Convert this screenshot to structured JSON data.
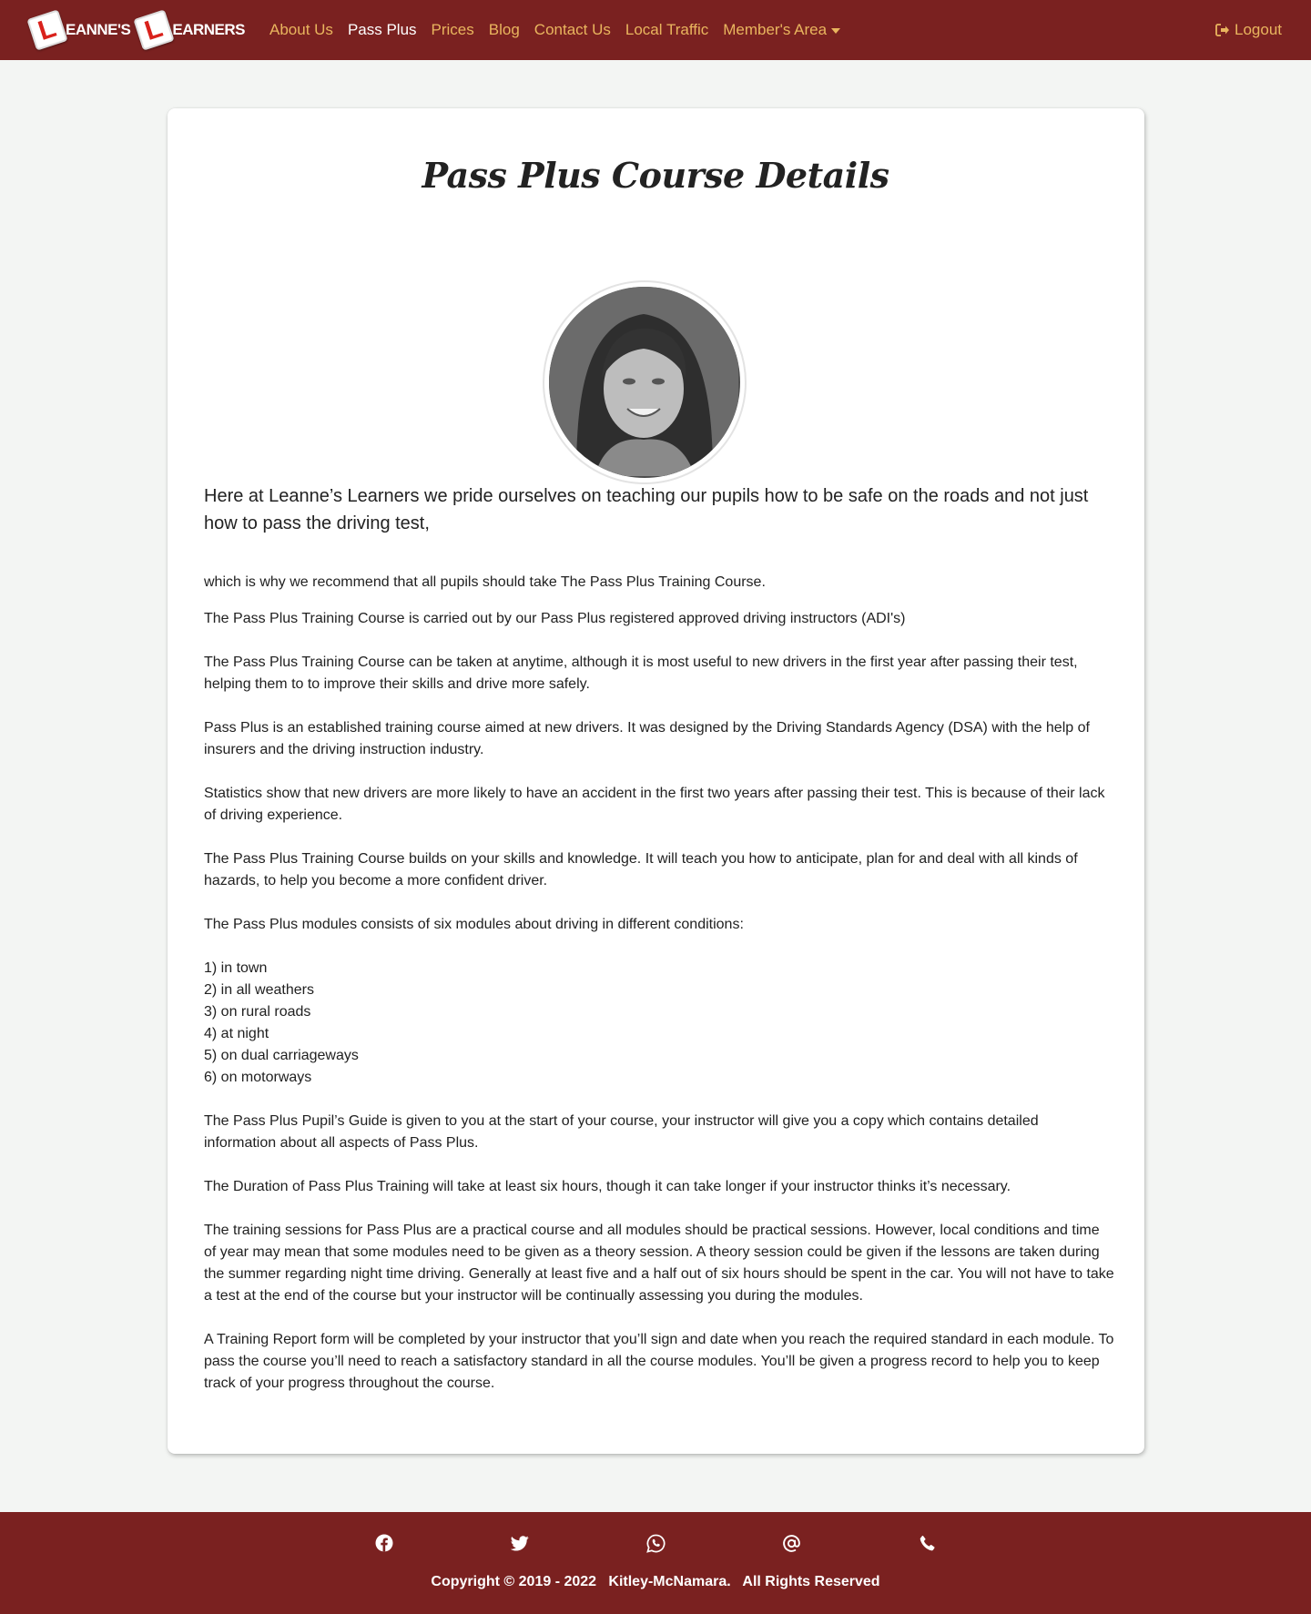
{
  "navbar": {
    "logo": {
      "word1": "EANNE'S",
      "word2": "EARNERS",
      "plate_letter": "L"
    },
    "links": [
      {
        "label": "About Us",
        "active": false
      },
      {
        "label": "Pass Plus",
        "active": true
      },
      {
        "label": "Prices",
        "active": false
      },
      {
        "label": "Blog",
        "active": false
      },
      {
        "label": "Contact Us",
        "active": false
      },
      {
        "label": "Local Traffic",
        "active": false
      },
      {
        "label": "Member's Area",
        "active": false,
        "dropdown": true
      }
    ],
    "logout_label": "Logout"
  },
  "main": {
    "title": "Pass Plus Course Details",
    "lead": "Here at Leanne’s Learners we pride ourselves on teaching our pupils how to be safe on the roads and not just how to pass the driving test,",
    "paragraphs": [
      "which is why we recommend that all pupils should take The Pass Plus Training Course.",
      "The Pass Plus Training Course is carried out by our Pass Plus registered approved driving instructors (ADI's)",
      "The Pass Plus Training Course can be taken at anytime, although it is most useful to new drivers in the first year after passing their test, helping them to to improve their skills and drive more safely.",
      "Pass Plus is an established training course aimed at new drivers. It was designed by the Driving Standards Agency (DSA) with the help of insurers and the driving instruction industry.",
      "Statistics show that new drivers are more likely to have an accident in the first two years after passing their test. This is because of their lack of driving experience.",
      "The Pass Plus Training Course builds on your skills and knowledge. It will teach you how to anticipate, plan for and deal with all kinds of hazards, to help you become a more confident driver.",
      "The Pass Plus modules consists of six modules about driving in different conditions:"
    ],
    "modules": [
      "1) in town",
      "2) in all weathers",
      "3) on rural roads",
      "4) at night",
      "5) on dual carriageways",
      "6) on motorways"
    ],
    "paragraphs_after": [
      "The Pass Plus Pupil’s Guide is given to you at the start of your course, your instructor will give you a copy which contains detailed information about all aspects of Pass Plus.",
      "The Duration of Pass Plus Training will take at least six hours, though it can take longer if your instructor thinks it’s necessary.",
      "The training sessions for Pass Plus are a practical course and all modules should be practical sessions. However, local conditions and time of year may mean that some modules need to be given as a theory session. A theory session could be given if the lessons are taken during the summer regarding night time driving. Generally at least five and a half out of six hours should be spent in the car. You will not have to take a test at the end of the course but your instructor will be continually assessing you during the modules.",
      "A Training Report form will be completed by your instructor that you’ll sign and date when you reach the required standard in each module. To pass the course you’ll need to reach a satisfactory standard in all the course modules. You’ll be given a progress record to help you to keep track of your progress throughout the course."
    ]
  },
  "footer": {
    "social_icons": [
      "facebook-icon",
      "twitter-icon",
      "whatsapp-icon",
      "at-sign-icon",
      "phone-icon"
    ],
    "copyright": "Copyright © 2019 - 2022   Kitley-McNamara.   All Rights Reserved"
  },
  "colors": {
    "brand": "#7a2120",
    "nav_link": "#e9b55e",
    "page_bg": "#f3f5f3"
  }
}
